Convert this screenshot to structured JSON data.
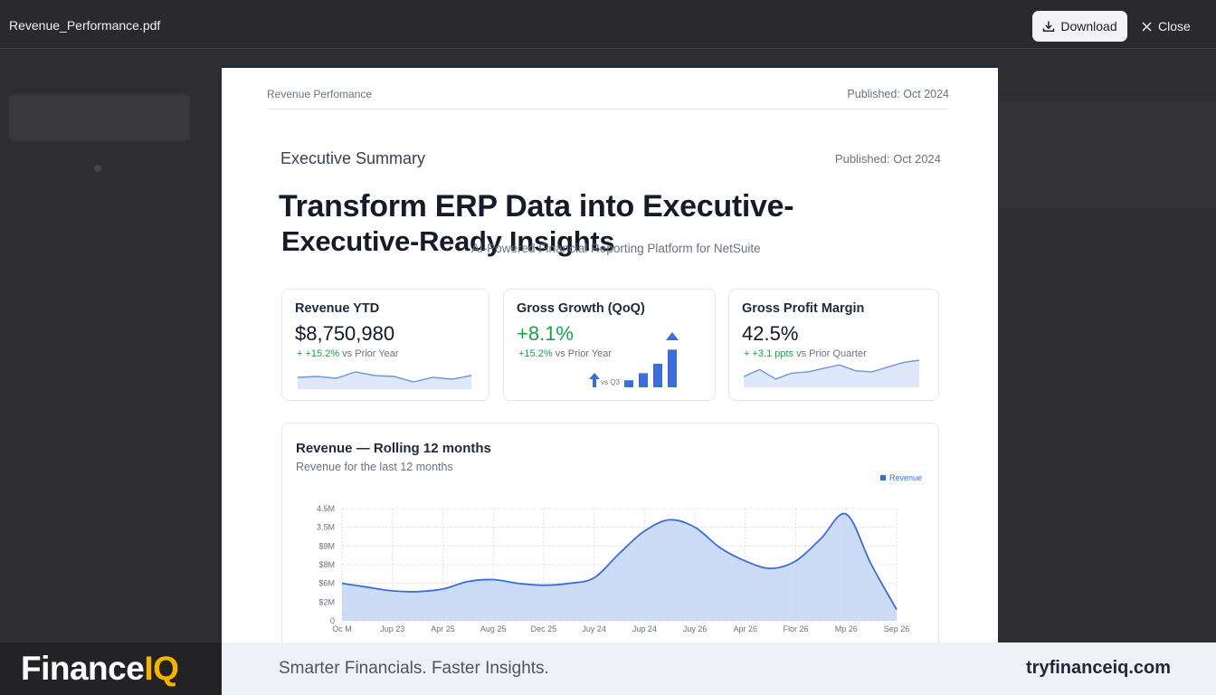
{
  "viewer": {
    "filename": "Revenue_Performance.pdf",
    "download_label": "Download",
    "close_label": "Close"
  },
  "document": {
    "header_left": "Revenue Perfomance",
    "header_right": "Published: Oct 2024",
    "section_title": "Executive Summary",
    "section_published": "Published: Oct 2024",
    "headline_line1": "Transform ERP Data into Executive-",
    "headline_line2": "Executive-Ready Insights",
    "subheadline": "AI-Powered Financial Reporting Platform for NetSuite"
  },
  "kpis": [
    {
      "title": "Revenue YTD",
      "value": "$8,750,980",
      "delta": "+15.2%",
      "delta_suffix": "vs Prior Year",
      "trend": [
        0.55,
        0.5,
        0.6,
        0.25,
        0.45,
        0.5,
        0.8,
        0.55,
        0.65,
        0.45
      ]
    },
    {
      "title": "Gross Growth (QoQ)",
      "value": "+8.1%",
      "delta": "+15.2%",
      "delta_suffix": "vs Prior Year",
      "bar_note": "vs Q3",
      "bars": [
        0.15,
        0.3,
        0.5,
        0.8
      ]
    },
    {
      "title": "Gross Profit Margin",
      "value": "42.5%",
      "delta": "+3.1 ppts",
      "delta_suffix": "vs Prior Quarter",
      "trend": [
        0.7,
        0.4,
        0.8,
        0.55,
        0.5,
        0.35,
        0.2,
        0.45,
        0.5,
        0.3,
        0.1,
        0.0
      ]
    }
  ],
  "revenue_chart": {
    "title": "Revenue — Rolling 12 months",
    "subtitle": "Revenue for the last 12 months",
    "legend": "Revenue"
  },
  "chart_data": {
    "type": "area",
    "title": "Revenue — Rolling 12 months",
    "x": [
      "Oc M",
      "Jup 23",
      "Apr 25",
      "Aug 25",
      "Dec 25",
      "Juy 24",
      "Jup 24",
      "Juy 26",
      "Apr 26",
      "Flor 26",
      "Mp 26",
      "Sep 26"
    ],
    "y_ticks": [
      "0",
      "$2M",
      "$6M",
      "$8M",
      "$9M",
      "3.5M",
      "4.5M"
    ],
    "y_tick_values": [
      0,
      0.5,
      1.0,
      1.5,
      2.0,
      2.5,
      3.0
    ],
    "series": [
      {
        "name": "Revenue",
        "x": [
          0,
          0.5,
          1,
          1.5,
          2,
          2.5,
          3,
          3.5,
          4,
          4.5,
          5,
          5.5,
          6,
          6.5,
          7,
          7.5,
          8,
          8.5,
          9,
          9.5,
          10,
          10.5,
          11
        ],
        "values": [
          1.0,
          0.9,
          0.8,
          0.78,
          0.85,
          1.05,
          1.1,
          1.0,
          0.95,
          1.0,
          1.15,
          1.8,
          2.4,
          2.7,
          2.5,
          1.95,
          1.6,
          1.4,
          1.6,
          2.2,
          2.85,
          1.5,
          0.3
        ]
      }
    ],
    "ylim": [
      0,
      3.0
    ],
    "grid": true,
    "legend_position": "top-right",
    "color": "#3b6fd6",
    "fill": "#c7d7f5"
  },
  "footer": {
    "brand_main": "Finance",
    "brand_accent": "IQ",
    "tagline": "Smarter Financials. Faster Insights.",
    "website": "tryfinanceiq.com"
  }
}
